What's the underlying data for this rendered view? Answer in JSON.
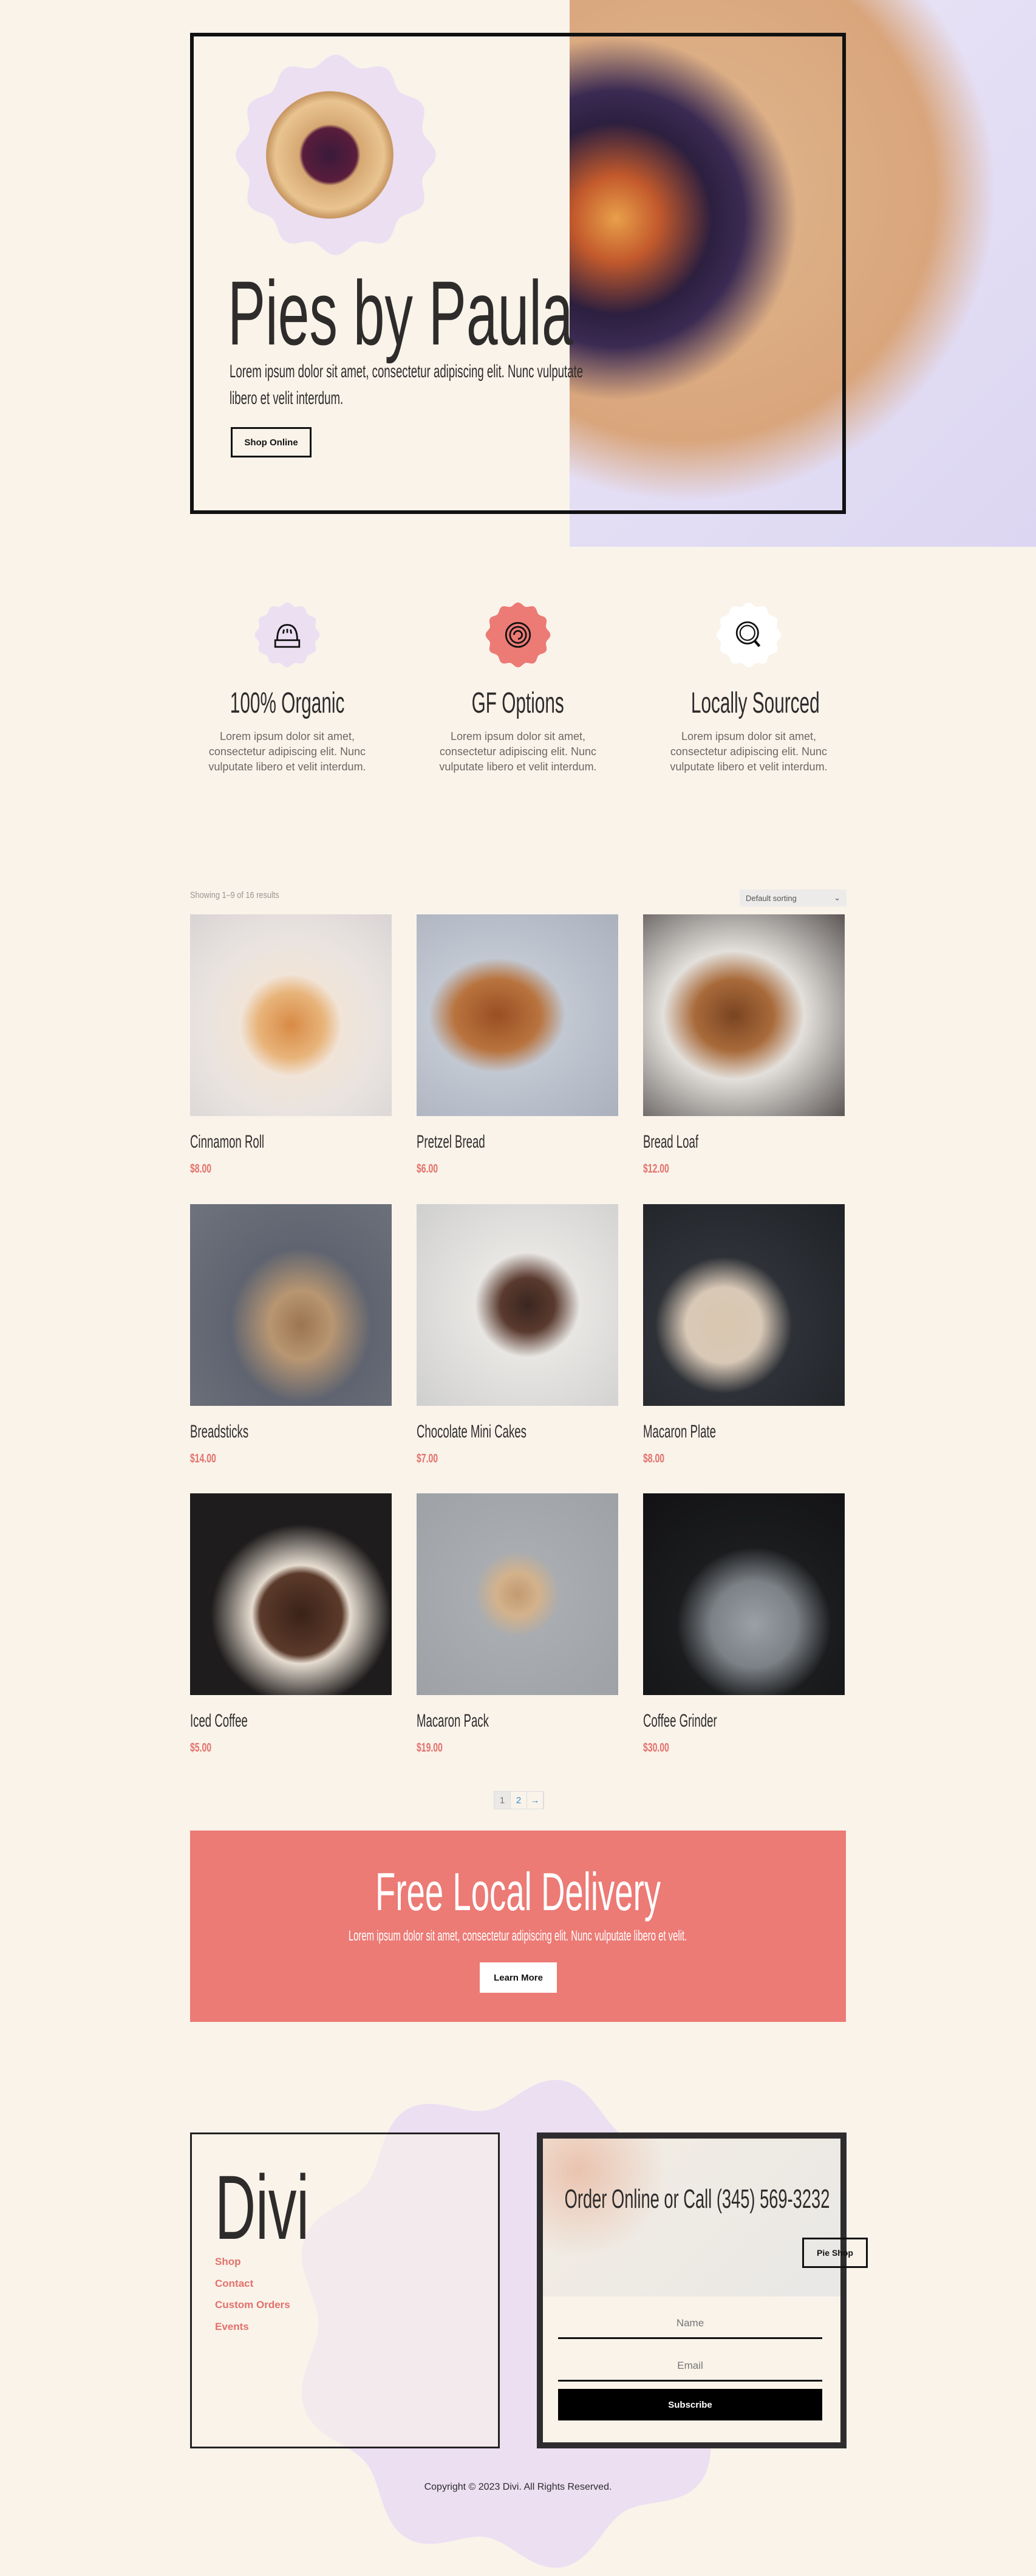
{
  "colors": {
    "background": "#f9f3ea",
    "accent": "#ec7a75",
    "lavender": "#ecdff2",
    "dark": "#2e2b2b"
  },
  "hero": {
    "title": "Pies by Paula",
    "text": "Lorem ipsum dolor sit amet, consectetur adipiscing elit. Nunc vulputate libero et velit interdum.",
    "button": "Shop Online"
  },
  "features": [
    {
      "icon": "pie-dome-icon",
      "title": "100% Organic",
      "text": "Lorem ipsum dolor sit amet, consectetur adipiscing elit. Nunc vulputate libero et velit interdum.",
      "badge_color": "#ecdff2"
    },
    {
      "icon": "spiral-pie-icon",
      "title": "GF Options",
      "text": "Lorem ipsum dolor sit amet, consectetur adipiscing elit. Nunc vulputate libero et velit interdum.",
      "badge_color": "#ec7a75"
    },
    {
      "icon": "magnifier-icon",
      "title": "Locally Sourced",
      "text": "Lorem ipsum dolor sit amet, consectetur adipiscing elit. Nunc vulputate libero et velit interdum.",
      "badge_color": "#ffffff"
    }
  ],
  "shop": {
    "result_count": "Showing 1–9 of 16 results",
    "sort_selected": "Default sorting",
    "products": [
      {
        "name": "Cinnamon Roll",
        "price": "$8.00"
      },
      {
        "name": "Pretzel Bread",
        "price": "$6.00"
      },
      {
        "name": "Bread Loaf",
        "price": "$12.00"
      },
      {
        "name": "Breadsticks",
        "price": "$14.00"
      },
      {
        "name": "Chocolate Mini Cakes",
        "price": "$7.00"
      },
      {
        "name": "Macaron Plate",
        "price": "$8.00"
      },
      {
        "name": "Iced Coffee",
        "price": "$5.00"
      },
      {
        "name": "Macaron Pack",
        "price": "$19.00"
      },
      {
        "name": "Coffee Grinder",
        "price": "$30.00"
      }
    ],
    "pagination": {
      "current": "1",
      "pages": [
        "1",
        "2"
      ],
      "next": "→"
    }
  },
  "delivery": {
    "title": "Free Local Delivery",
    "text": "Lorem ipsum dolor sit amet, consectetur adipiscing elit. Nunc vulputate libero et velit.",
    "button": "Learn More"
  },
  "footer": {
    "logo": "Divi",
    "links": [
      "Shop",
      "Contact",
      "Custom Orders",
      "Events"
    ],
    "order_title": "Order Online or Call (345) 569-3232",
    "pie_shop_button": "Pie Shop",
    "name_placeholder": "Name",
    "email_placeholder": "Email",
    "subscribe": "Subscribe",
    "copyright": "Copyright © 2023 Divi. All Rights Reserved."
  }
}
